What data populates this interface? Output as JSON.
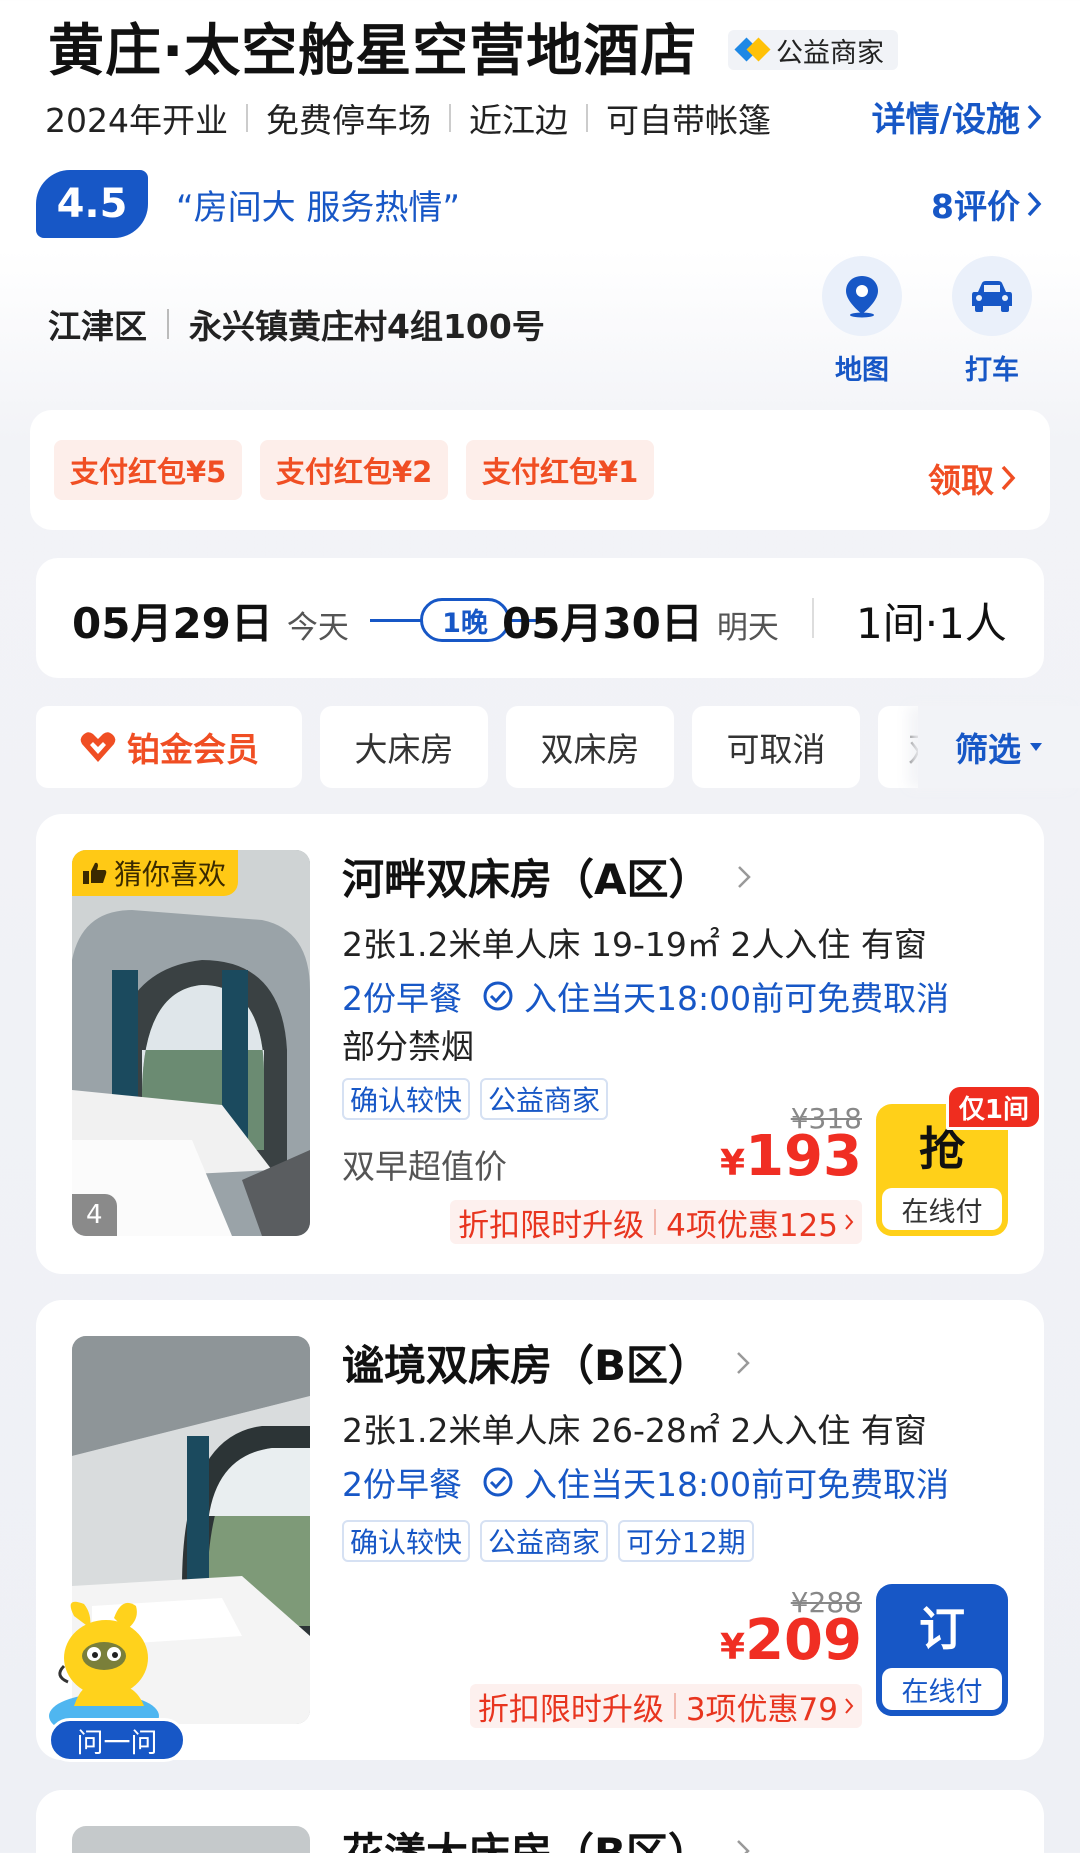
{
  "hotel": {
    "name": "黄庄·太空舱星空营地酒店",
    "charity_badge": "公益商家",
    "features": [
      "2024年开业",
      "免费停车场",
      "近江边",
      "可自带帐篷"
    ],
    "detail_link": "详情/设施",
    "rating": "4.5",
    "rating_quote": "“房间大 服务热情”",
    "reviews_link": "8评价",
    "district": "江津区",
    "street": "永兴镇黄庄村4组100号",
    "map_label": "地图",
    "taxi_label": "打车"
  },
  "coupons": {
    "items": [
      "支付红包¥5",
      "支付红包¥2",
      "支付红包¥1"
    ],
    "claim_label": "领取"
  },
  "dates": {
    "checkin": "05月29日",
    "checkin_sub": "今天",
    "nights": "1晚",
    "checkout": "05月30日",
    "checkout_sub": "明天",
    "guests": "1间·1人"
  },
  "filters": {
    "member": "铂金会员",
    "chips": [
      "大床房",
      "双床房",
      "可取消",
      "双"
    ],
    "filter_label": "筛选"
  },
  "rooms": [
    {
      "name": "河畔双床房（A区）",
      "spec": "2张1.2米单人床  19-19㎡  2人入住  有窗",
      "breakfast": "2份早餐",
      "cancel": "入住当天18:00前可免费取消",
      "extra": "部分禁烟",
      "tags": [
        "确认较快",
        "公益商家"
      ],
      "value_label": "双早超值价",
      "old_price": "¥318",
      "currency": "¥",
      "price": "193",
      "promo_left": "折扣限时升级",
      "promo_right": "4项优惠125",
      "badge": "猜你喜欢",
      "photo_count": "4",
      "only_badge": "仅1间",
      "btn_main": "抢",
      "btn_sub": "在线付"
    },
    {
      "name": "谧境双床房（B区）",
      "spec": "2张1.2米单人床  26-28㎡  2人入住  有窗",
      "breakfast": "2份早餐",
      "cancel": "入住当天18:00前可免费取消",
      "tags": [
        "确认较快",
        "公益商家",
        "可分12期"
      ],
      "old_price": "¥288",
      "currency": "¥",
      "price": "209",
      "promo_left": "折扣限时升级",
      "promo_right": "3项优惠79",
      "btn_main": "订",
      "btn_sub": "在线付"
    },
    {
      "name": "花漾大床房（B区）"
    }
  ],
  "assistant": {
    "label": "问一问"
  },
  "colors": {
    "brand_blue": "#1757c6",
    "price_red": "#f02e23",
    "coupon_orange": "#f04e23",
    "grab_yellow": "#ffd019"
  }
}
